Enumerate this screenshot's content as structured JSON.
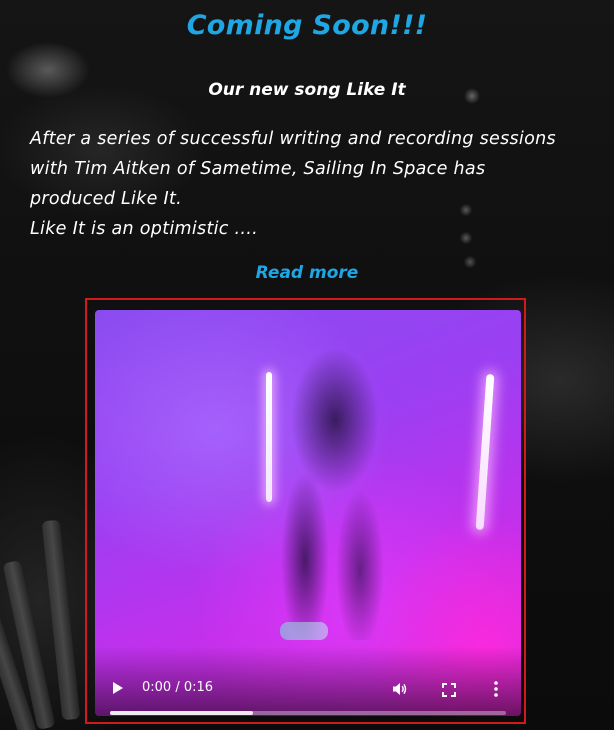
{
  "heading": {
    "title": "Coming Soon!!!",
    "subtitle": "Our new song Like It"
  },
  "description": {
    "lines": [
      "After a series of successful writing and recording sessions",
      "with Tim Aitken of Sametime, Sailing In Space has",
      "produced Like It.",
      "Like It is an optimistic ...."
    ]
  },
  "read_more_label": "Read more",
  "video": {
    "time_display": "0:00 / 0:16",
    "buffered_fraction": 0.36,
    "play_icon": "play-icon",
    "volume_icon": "volume-icon",
    "fullscreen_icon": "fullscreen-icon",
    "more_icon": "more-options-icon"
  },
  "colors": {
    "accent": "#1ea7e4",
    "highlight_border": "#d11a1a"
  }
}
